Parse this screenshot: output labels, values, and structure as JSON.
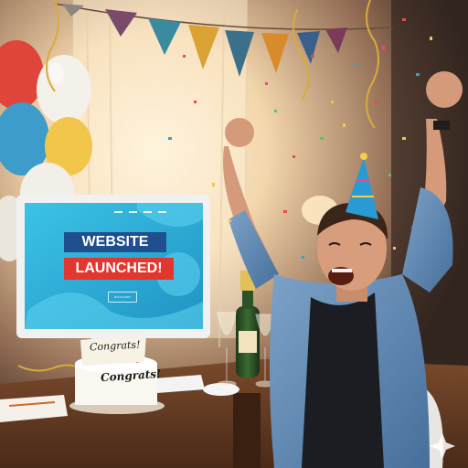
{
  "screen": {
    "headline_line1": "WEBSITE",
    "headline_line2": "LAUNCHED!",
    "button_text": "DISCOVER"
  },
  "card": {
    "text": "Congrats!"
  },
  "cake": {
    "text": "Congrats!"
  },
  "colors": {
    "screen_bg": "#2fb3d8",
    "headline_blue": "#1f4f8f",
    "headline_red": "#e2372f",
    "shirt": "#5b85b0",
    "party_hat": "#2a9ad4"
  }
}
